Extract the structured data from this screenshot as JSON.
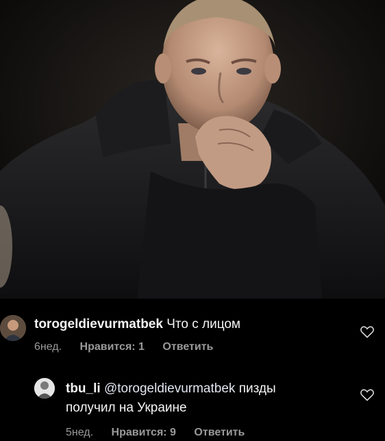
{
  "photo": {
    "subject": "man in dark jacket touching face"
  },
  "comments": [
    {
      "username": "torogeldievurmatbek",
      "text": "Что с лицом",
      "age": "6нед.",
      "likes": "Нравится: 1",
      "reply": "Ответить",
      "like_icon": "heart-icon"
    },
    {
      "username": "tbu_li",
      "mention": "@torogeldievurmatbek",
      "text_line1": "пизды",
      "text_line2": "получил на Украине",
      "age": "5нед.",
      "likes": "Нравится: 9",
      "reply": "Ответить",
      "like_icon": "heart-icon"
    }
  ],
  "colors": {
    "background": "#000000",
    "text": "#f5f5f5",
    "meta": "#9a9a9a"
  }
}
